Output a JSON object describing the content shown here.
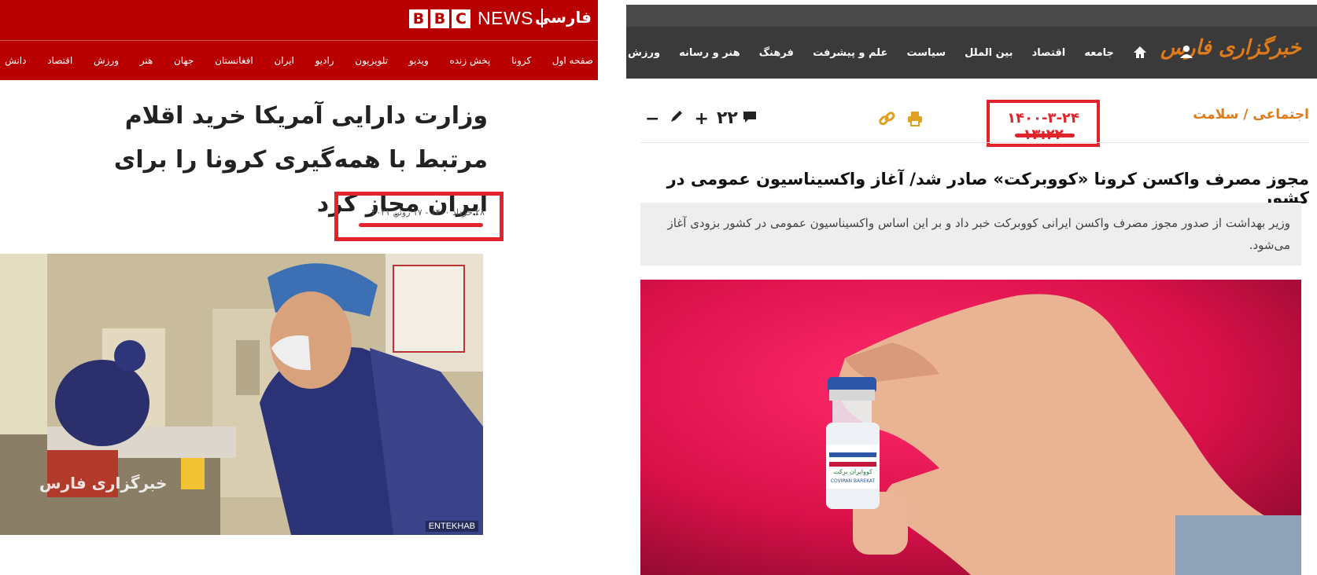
{
  "bbc": {
    "logo_letters": [
      "B",
      "B",
      "C"
    ],
    "news_label": "NEWS",
    "farsi_label": "فارسی",
    "nav": [
      "صفحه اول",
      "کرونا",
      "پخش زنده",
      "ویدیو",
      "تلویزیون",
      "رادیو",
      "ایران",
      "افغانستان",
      "جهان",
      "هنر",
      "ورزش",
      "اقتصاد",
      "دانش"
    ],
    "headline": "وزارت دارایی آمریکا خرید اقلام مرتبط با همه‌گیری کرونا را برای ایران مجاز کرد",
    "date": "۲۸ خرداد ۱۴۰۰ - ۱۷ ژوئن ۲۰۲۱",
    "photo_credit": "ENTEKHAB",
    "photo_watermark": "خبرگزاری فارس"
  },
  "fars": {
    "logo": "خبرگزاری فارس",
    "menu": [
      "جامعه",
      "اقتصاد",
      "بین الملل",
      "سیاست",
      "علم و پیشرفت",
      "فرهنگ",
      "هنر و رسانه",
      "ورزش"
    ],
    "breadcrumb": "اجتماعی / سلامت",
    "datetime": "۱۴۰۰-۳-۲۴ ۱۳:۲۲",
    "comment_count": "۲۲",
    "font_plus": "+",
    "font_minus": "−",
    "title": "مجوز مصرف واکسن کرونا «کوو‌برکت» صادر شد/ آغاز واکسیناسیون عمومی در کشور",
    "lead": "وزیر بهداشت از صدور مجوز مصرف واکسن ایرانی کوو‌برکت خبر داد و بر این اساس واکسیناسیون عمومی در کشور بزودی آغاز می‌شود.",
    "vial_label": "COVIRAN BAREKAT",
    "vial_label_fa": "کوو‌ایران برکت"
  },
  "colors": {
    "bbc_red": "#b80000",
    "highlight_red": "#e2232a",
    "fars_orange": "#e07b1a",
    "fars_nav": "#3a3a3a"
  }
}
